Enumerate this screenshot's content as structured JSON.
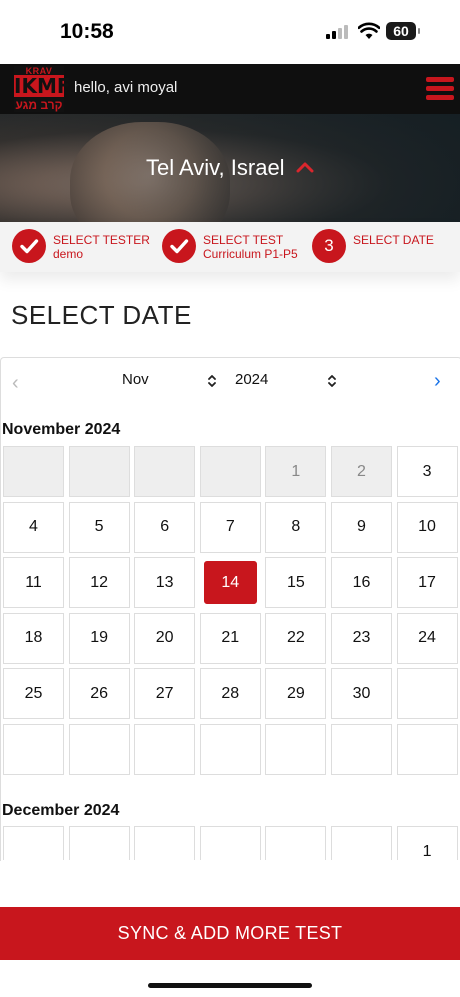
{
  "status_bar": {
    "time": "10:58",
    "battery": "60"
  },
  "header": {
    "logo": {
      "line1": "KRAV MAGA",
      "line2": "IKMF",
      "line3": "קרב מגע"
    },
    "greeting": "hello, avi moyal"
  },
  "hero": {
    "location": "Tel Aviv, Israel"
  },
  "steps": [
    {
      "title": "SELECT TESTER",
      "subtitle": "demo",
      "icon": "check-icon"
    },
    {
      "title": "SELECT TEST",
      "subtitle": "Curriculum P1-P5",
      "icon": "check-icon"
    },
    {
      "title": "SELECT DATE",
      "number": "3"
    }
  ],
  "page_title": "SELECT DATE",
  "calendar": {
    "selected_month": "Nov",
    "selected_year": "2024",
    "months": [
      {
        "label": "November 2024",
        "days": [
          "",
          "",
          "",
          "",
          "1",
          "2",
          "3",
          "4",
          "5",
          "6",
          "7",
          "8",
          "9",
          "10",
          "11",
          "12",
          "13",
          "14",
          "15",
          "16",
          "17",
          "18",
          "19",
          "20",
          "21",
          "22",
          "23",
          "24",
          "25",
          "26",
          "27",
          "28",
          "29",
          "30",
          "",
          "",
          "",
          "",
          "",
          "",
          "",
          ""
        ],
        "selected_day": "14"
      },
      {
        "label": "December 2024",
        "days": [
          "",
          "",
          "",
          "",
          "",
          "",
          "1"
        ]
      }
    ]
  },
  "sync_button": "SYNC & ADD MORE TEST",
  "colors": {
    "brand_red": "#c8161d",
    "header_bg": "#0f0f0f",
    "link_blue": "#1a73e8"
  }
}
